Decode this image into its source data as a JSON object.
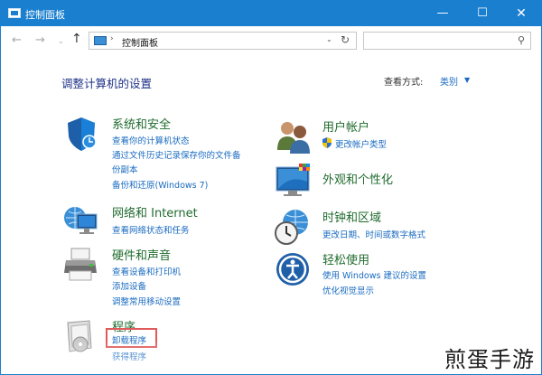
{
  "window": {
    "title": "控制面板",
    "minimize_glyph": "—",
    "maximize_glyph": "☐",
    "close_glyph": "✕"
  },
  "nav": {
    "back_glyph": "←",
    "forward_glyph": "→",
    "recent_glyph": "⌄",
    "up_glyph": "↑",
    "breadcrumb_sep": "›",
    "address": "控制面板",
    "dropdown_glyph": "⌄",
    "refresh_glyph": "↻",
    "search_glyph": "⚲",
    "search_placeholder": ""
  },
  "main": {
    "page_title": "调整计算机的设置",
    "view_by_label": "查看方式:",
    "view_by_value": "类别",
    "view_caret": "▼"
  },
  "categories": {
    "security": {
      "title": "系统和安全",
      "icon": "shield-icon",
      "links": [
        "查看你的计算机状态",
        "通过文件历史记录保存你的文件备",
        "份副本",
        "备份和还原(Windows 7)"
      ]
    },
    "network": {
      "title": "网络和 Internet",
      "icon": "network-icon",
      "links": [
        "查看网络状态和任务"
      ]
    },
    "hardware": {
      "title": "硬件和声音",
      "icon": "printer-icon",
      "links": [
        "查看设备和打印机",
        "添加设备",
        "调整常用移动设置"
      ]
    },
    "programs": {
      "title": "程序",
      "icon": "programs-icon",
      "links": [
        "卸载程序",
        "获得程序"
      ]
    },
    "accounts": {
      "title": "用户帐户",
      "icon": "users-icon",
      "links": [
        "更改帐户类型"
      ]
    },
    "appearance": {
      "title": "外观和个性化",
      "icon": "appearance-icon",
      "links": []
    },
    "clock": {
      "title": "时钟和区域",
      "icon": "clock-icon",
      "links": [
        "更改日期、时间或数字格式"
      ]
    },
    "ease": {
      "title": "轻松使用",
      "icon": "ease-of-access-icon",
      "links": [
        "使用 Windows 建议的设置",
        "优化视觉显示"
      ]
    }
  },
  "watermark": "煎蛋手游",
  "colors": {
    "titlebar": "#1b7fcf",
    "category_title": "#1f6b2d",
    "link": "#1a6bc0",
    "heading": "#1e3287",
    "highlight": "#e05a5a"
  }
}
